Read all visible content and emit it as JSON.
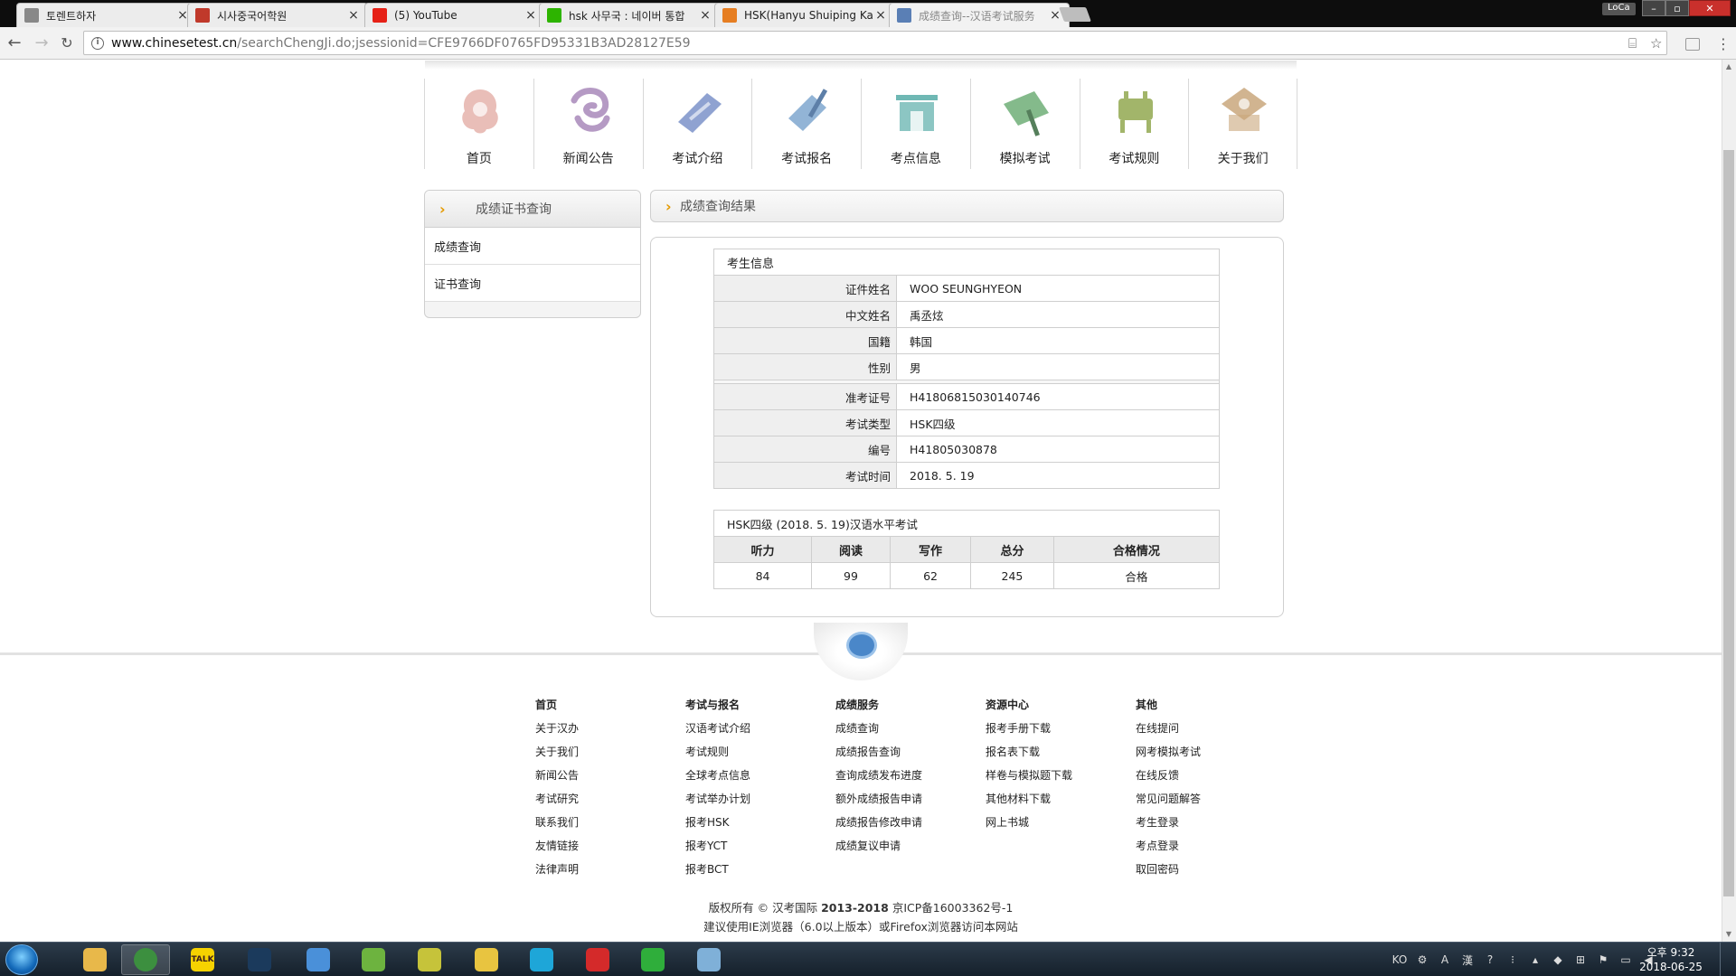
{
  "browser": {
    "tabs": [
      {
        "title": "토렌트하자",
        "favicon": "page-icon",
        "color": "#888888"
      },
      {
        "title": "시사중국어학원",
        "favicon": "academy-icon",
        "color": "#c0392b"
      },
      {
        "title": "(5) YouTube",
        "favicon": "youtube-icon",
        "color": "#e62117"
      },
      {
        "title": "hsk 사무국 : 네이버 통합",
        "favicon": "naver-icon",
        "color": "#2db400"
      },
      {
        "title": "HSK(Hanyu Shuiping Ka",
        "favicon": "hsk-icon",
        "color": "#e67e22"
      },
      {
        "title": "成绩查询--汉语考试服务",
        "favicon": "chinesetest-icon",
        "color": "#5a7fb5"
      }
    ],
    "profile": "LoCa",
    "url_host": "www.chinesetest.cn",
    "url_path": "/searchChengJi.do;jsessionid=CFE9766DF0765FD95331B3AD28127E59"
  },
  "nav": [
    {
      "label": "首页",
      "icon": "home-icon",
      "color": "#e7b7b0"
    },
    {
      "label": "新闻公告",
      "icon": "news-icon",
      "color": "#b59ac4"
    },
    {
      "label": "考试介绍",
      "icon": "exam-intro-icon",
      "color": "#7b92c9"
    },
    {
      "label": "考试报名",
      "icon": "registration-icon",
      "color": "#7fa7cf"
    },
    {
      "label": "考点信息",
      "icon": "test-center-icon",
      "color": "#6fb8b4"
    },
    {
      "label": "模拟考试",
      "icon": "mock-exam-icon",
      "color": "#6fae77"
    },
    {
      "label": "考试规则",
      "icon": "exam-rules-icon",
      "color": "#a2b56a"
    },
    {
      "label": "关于我们",
      "icon": "about-icon",
      "color": "#c9a77c"
    }
  ],
  "sidebar": {
    "title": "成绩证书查询",
    "links": [
      "成绩查询",
      "证书查询"
    ]
  },
  "result": {
    "title": "成绩查询结果",
    "candidate_caption": "考生信息",
    "fields_personal": [
      {
        "label": "证件姓名",
        "value": "WOO SEUNGHYEON"
      },
      {
        "label": "中文姓名",
        "value": "禹丞炫"
      },
      {
        "label": "国籍",
        "value": "韩国"
      },
      {
        "label": "性别",
        "value": "男"
      }
    ],
    "fields_exam": [
      {
        "label": "准考证号",
        "value": "H41806815030140746"
      },
      {
        "label": "考试类型",
        "value": "HSK四级"
      },
      {
        "label": "编号",
        "value": "H41805030878"
      },
      {
        "label": "考试时间",
        "value": "2018. 5. 19"
      }
    ],
    "score_caption": "HSK四级 (2018. 5. 19)汉语水平考试",
    "score_headers": [
      "听力",
      "阅读",
      "写作",
      "总分",
      "合格情况"
    ],
    "score_values": [
      "84",
      "99",
      "62",
      "245",
      "合格"
    ]
  },
  "footer": {
    "columns": [
      {
        "heading": "首页",
        "links": [
          "关于汉办",
          "关于我们",
          "新闻公告",
          "考试研究",
          "联系我们",
          "友情链接",
          "法律声明"
        ]
      },
      {
        "heading": "考试与报名",
        "links": [
          "汉语考试介绍",
          "考试规则",
          "全球考点信息",
          "考试举办计划",
          "报考HSK",
          "报考YCT",
          "报考BCT"
        ]
      },
      {
        "heading": "成绩服务",
        "links": [
          "成绩查询",
          "成绩报告查询",
          "查询成绩发布进度",
          "额外成绩报告申请",
          "成绩报告修改申请",
          "成绩复议申请"
        ]
      },
      {
        "heading": "资源中心",
        "links": [
          "报考手册下载",
          "报名表下载",
          "样卷与模拟题下载",
          "其他材料下载",
          "网上书城"
        ]
      },
      {
        "heading": "其他",
        "links": [
          "在线提问",
          "网考模拟考试",
          "在线反馈",
          "常见问题解答",
          "考生登录",
          "考点登录",
          "取回密码"
        ]
      }
    ],
    "copyright_prefix": "版权所有 © 汉考国际",
    "copyright_years": "2013-2018",
    "copyright_icp": "京ICP备16003362号-1",
    "browser_notice": "建议使用IE浏览器（6.0以上版本）或Firefox浏览器访问本网站"
  },
  "taskbar": {
    "apps": [
      {
        "name": "explorer",
        "icon": "folder-icon",
        "color": "#e8b84a",
        "label": ""
      },
      {
        "name": "chrome",
        "icon": "chrome-icon",
        "color": "#3c8f3f",
        "label": ""
      },
      {
        "name": "kakaotalk",
        "icon": "kakaotalk-icon",
        "color": "#f6d200",
        "label": "TALK"
      },
      {
        "name": "steam",
        "icon": "steam-icon",
        "color": "#1b3a5c",
        "label": ""
      },
      {
        "name": "alsong",
        "icon": "music-note-icon",
        "color": "#4a90d9",
        "label": ""
      },
      {
        "name": "utorrent",
        "icon": "utorrent-icon",
        "color": "#6db33f",
        "label": ""
      },
      {
        "name": "potplayer",
        "icon": "disc-icon",
        "color": "#c6c33a",
        "label": ""
      },
      {
        "name": "idea",
        "icon": "lightbulb-icon",
        "color": "#e8c440",
        "label": ""
      },
      {
        "name": "tiktok",
        "icon": "note-app-icon",
        "color": "#1ea6d8",
        "label": ""
      },
      {
        "name": "flash",
        "icon": "flash-icon",
        "color": "#d42a2a",
        "label": ""
      },
      {
        "name": "vim",
        "icon": "v-app-icon",
        "color": "#2fae3b",
        "label": ""
      },
      {
        "name": "paint",
        "icon": "paint-icon",
        "color": "#7fb0d8",
        "label": ""
      }
    ],
    "tray_lang": "KO",
    "clock_time": "오후 9:32",
    "clock_date": "2018-06-25"
  }
}
